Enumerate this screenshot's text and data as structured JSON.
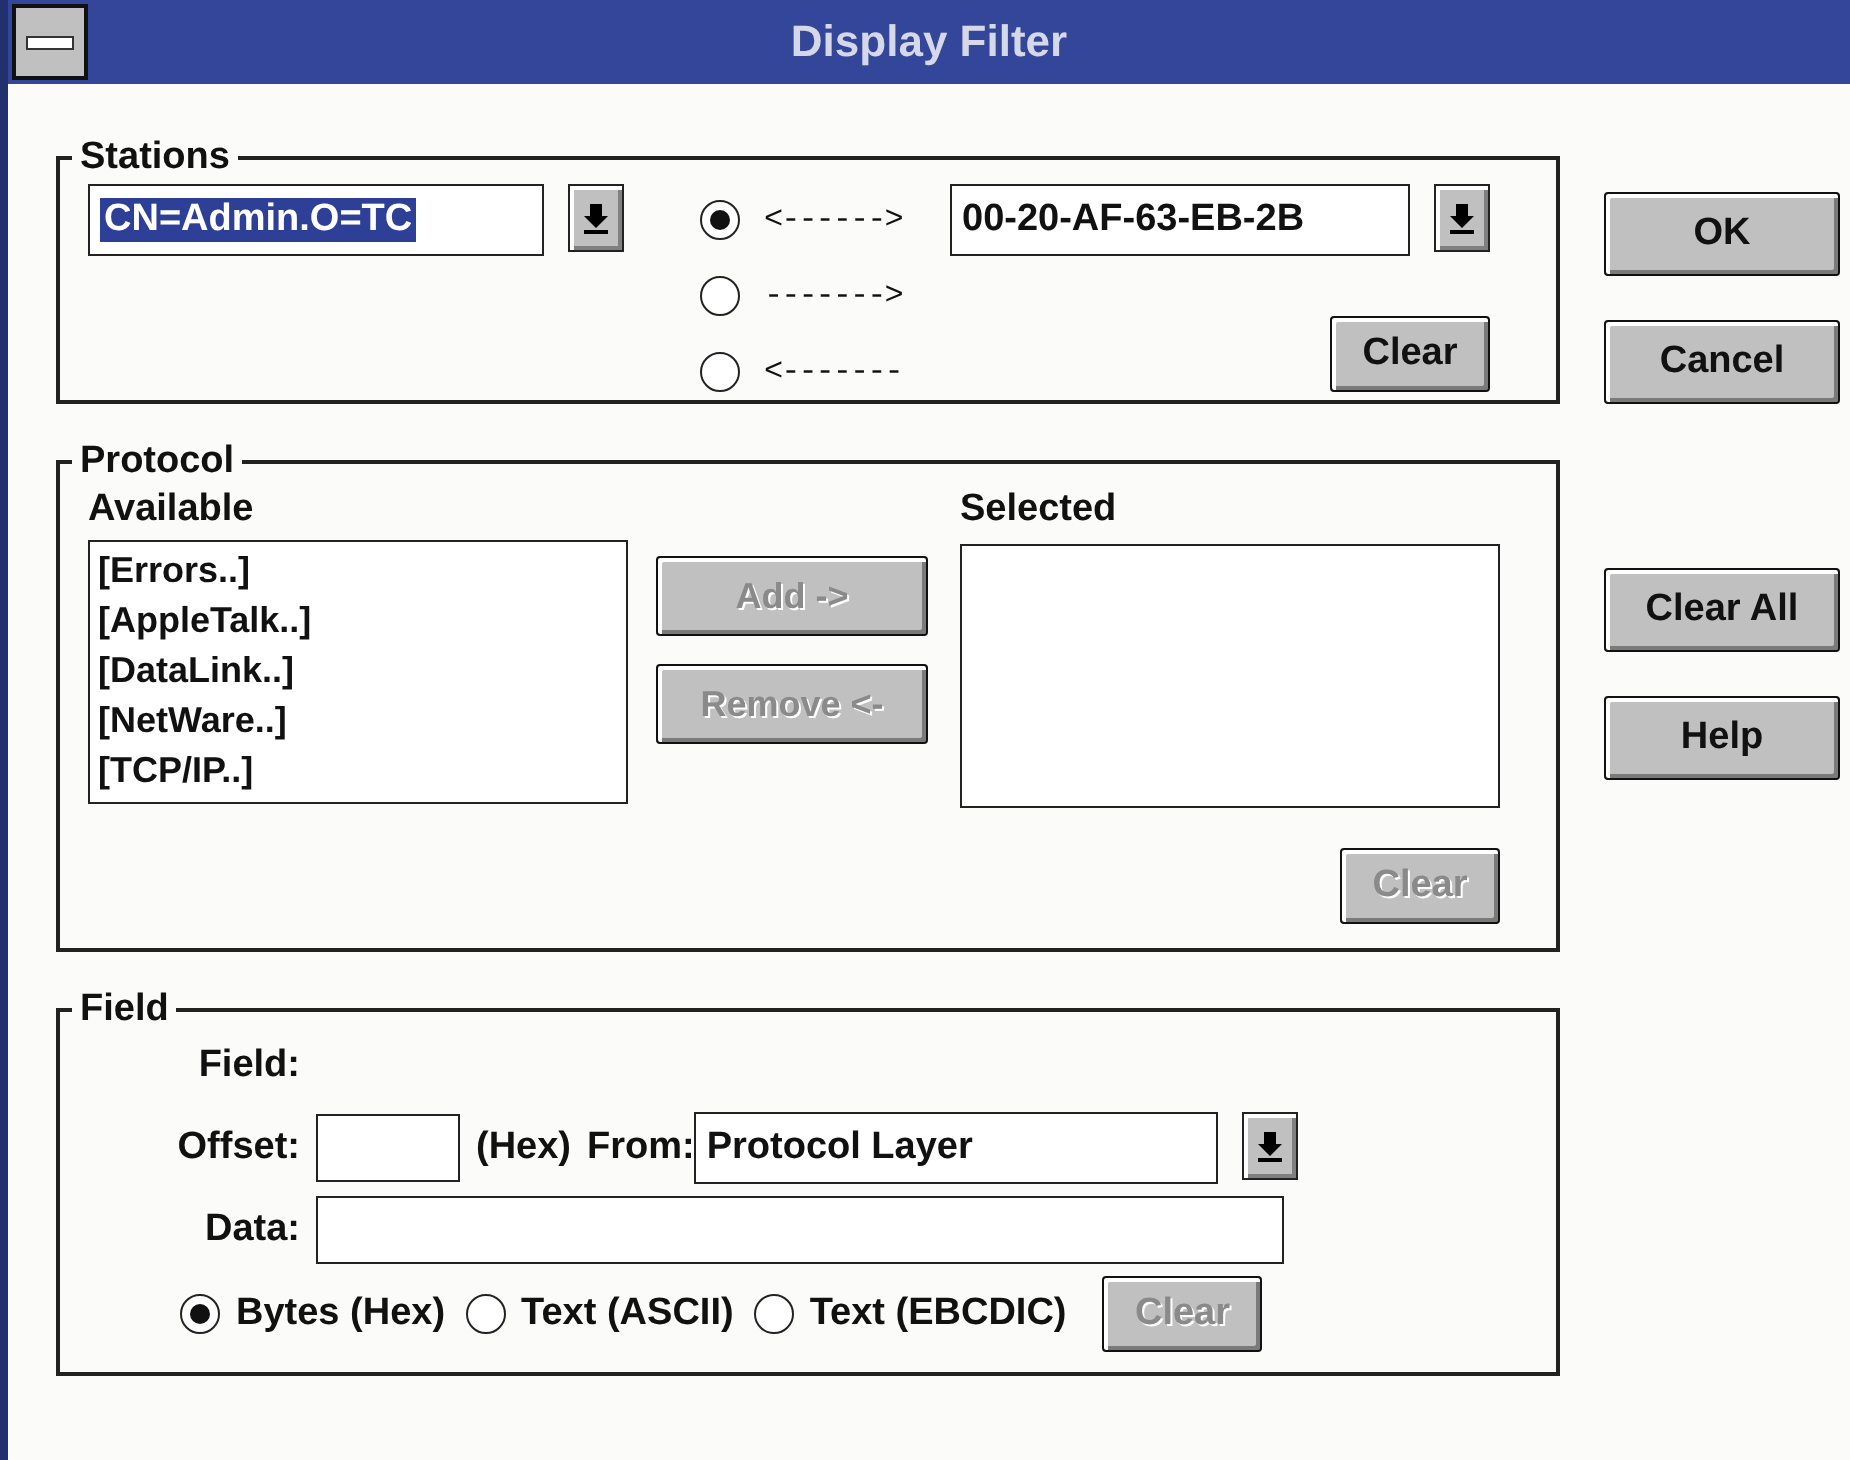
{
  "window": {
    "title": "Display Filter"
  },
  "stations": {
    "label": "Stations",
    "source": {
      "value": "CN=Admin.O=TC",
      "selected": true
    },
    "directions": [
      {
        "label": "<------>",
        "selected": true
      },
      {
        "label": "------->",
        "selected": false
      },
      {
        "label": "<-------",
        "selected": false
      }
    ],
    "destination": {
      "value": "00-20-AF-63-EB-2B"
    },
    "clear_button": {
      "label": "Clear",
      "disabled": false
    }
  },
  "protocol": {
    "label": "Protocol",
    "available_label": "Available",
    "available": [
      "[Errors..]",
      "[AppleTalk..]",
      "[DataLink..]",
      "[NetWare..]",
      "[TCP/IP..]"
    ],
    "add_button": {
      "label": "Add ->",
      "disabled": true
    },
    "remove_button": {
      "label": "Remove <-",
      "disabled": true
    },
    "selected_label": "Selected",
    "clear_button": {
      "label": "Clear",
      "disabled": true
    }
  },
  "field": {
    "label": "Field",
    "field_label": "Field:",
    "offset_label": "Offset:",
    "offset_unit": "(Hex)",
    "from_label": "From:",
    "from_value": "Protocol Layer",
    "data_label": "Data:",
    "formats": [
      {
        "label": "Bytes (Hex)",
        "selected": true
      },
      {
        "label": "Text (ASCII)",
        "selected": false
      },
      {
        "label": "Text (EBCDIC)",
        "selected": false
      }
    ],
    "clear_button": {
      "label": "Clear",
      "disabled": true
    }
  },
  "buttons_top": [
    {
      "label": "OK",
      "disabled": false
    },
    {
      "label": "Cancel",
      "disabled": false
    }
  ],
  "buttons_bottom": [
    {
      "label": "Clear All",
      "disabled": false
    },
    {
      "label": "Help",
      "disabled": false
    }
  ]
}
